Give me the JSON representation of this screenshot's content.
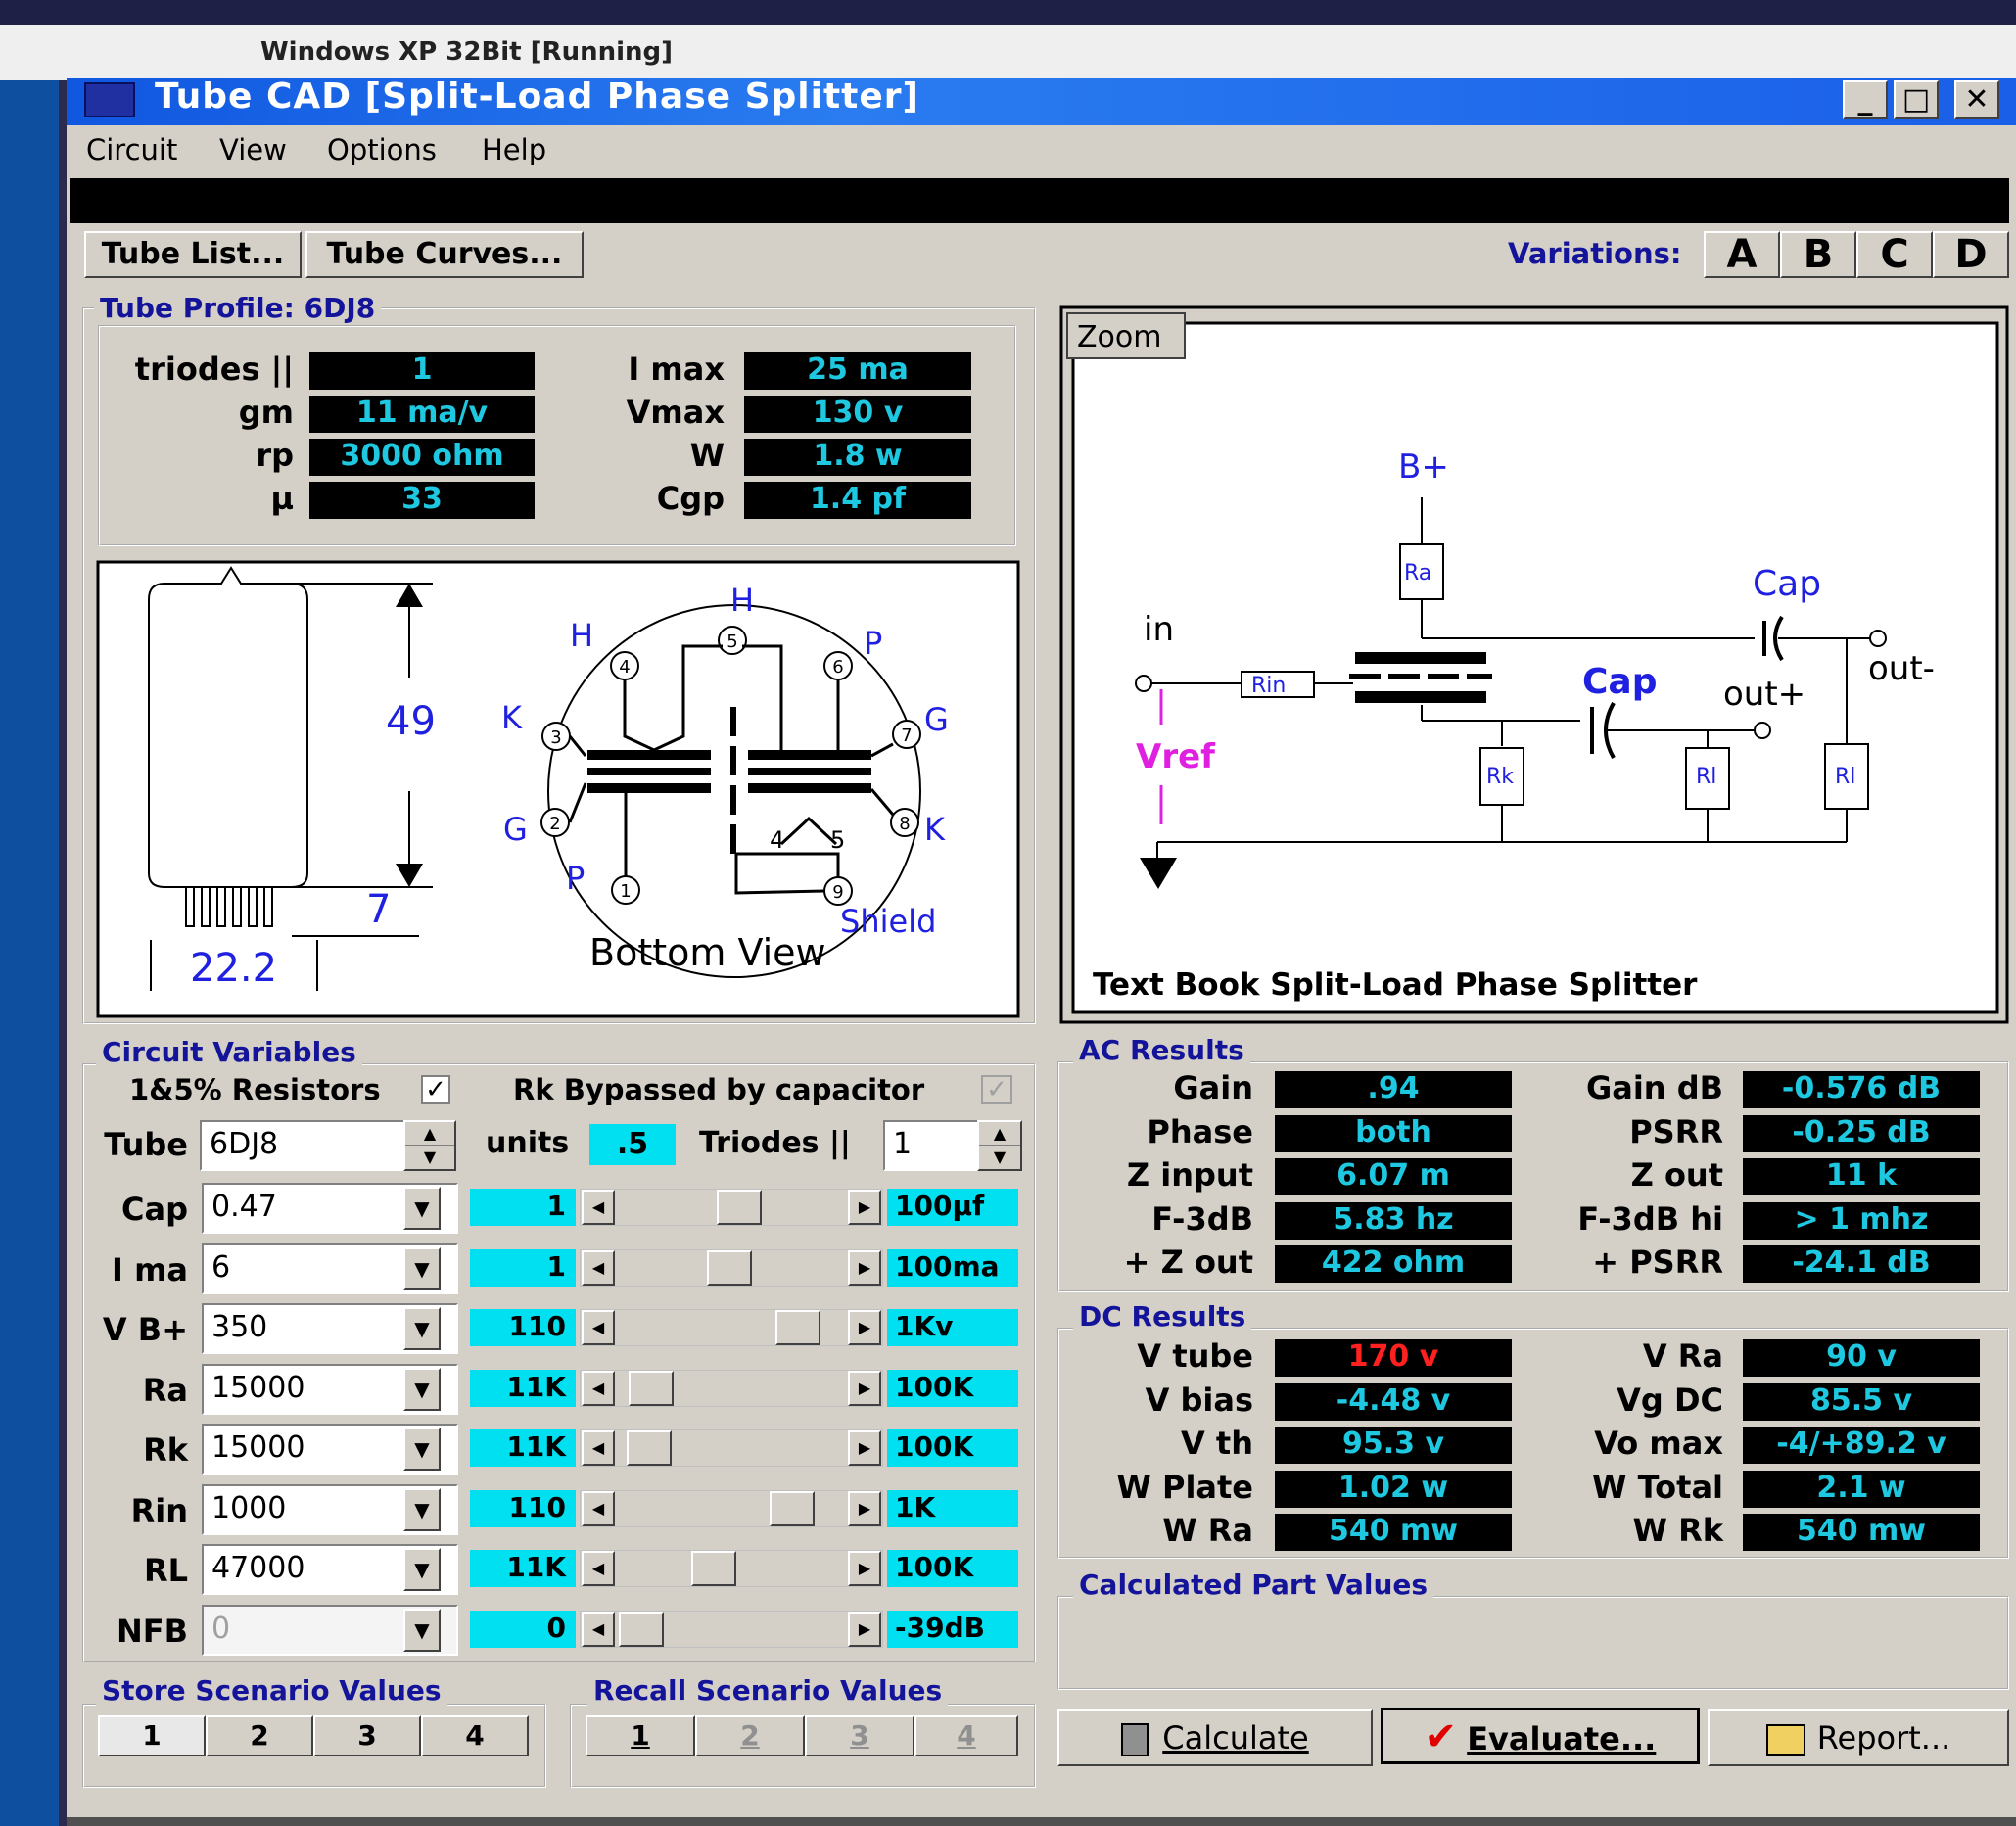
{
  "vm_title": "Windows XP 32Bit [Running]",
  "app": {
    "title": "Tube CAD    [Split-Load Phase Splitter]",
    "min_btn": "_",
    "max_btn": "□",
    "close_btn": "✕"
  },
  "menu": [
    "Circuit",
    "View",
    "Options",
    "Help"
  ],
  "toolbar": {
    "tube_list": "Tube List...",
    "tube_curves": "Tube Curves...",
    "variations_label": "Variations:",
    "variations": [
      "A",
      "B",
      "C",
      "D"
    ]
  },
  "tube_profile": {
    "title": "Tube Profile: 6DJ8",
    "left": [
      {
        "label": "triodes ||",
        "value": "1"
      },
      {
        "label": "gm",
        "value": "11 ma/v"
      },
      {
        "label": "rp",
        "value": "3000 ohm"
      },
      {
        "label": "µ",
        "value": "33"
      }
    ],
    "right": [
      {
        "label": "I max",
        "value": "25 ma"
      },
      {
        "label": "Vmax",
        "value": "130 v"
      },
      {
        "label": "W",
        "value": "1.8 w"
      },
      {
        "label": "Cgp",
        "value": "1.4 pf"
      }
    ]
  },
  "tube_drawing": {
    "height": "49",
    "pin_len": "7",
    "diameter": "22.2",
    "bottom_view": "Bottom View",
    "pins": [
      "1",
      "2",
      "3",
      "4",
      "5",
      "6",
      "7",
      "8",
      "9"
    ],
    "labels": {
      "h1": "H",
      "h2": "H",
      "p1": "P",
      "k1": "K",
      "g1": "G",
      "g2": "G",
      "k2": "K",
      "p2": "P",
      "shield": "Shield",
      "h4": "4",
      "h5": "5"
    }
  },
  "schematic": {
    "zoom": "Zoom",
    "caption": "Text Book Split-Load Phase Splitter",
    "bplus": "B+",
    "ra": "Ra",
    "cap1": "Cap",
    "cap2": "Cap",
    "in": "in",
    "rin": "Rin",
    "out_minus": "out-",
    "out_plus": "out+",
    "vref": "Vref",
    "rk": "Rk",
    "rl1": "Rl",
    "rl2": "Rl"
  },
  "circuit_variables": {
    "title": "Circuit Variables",
    "resistors": "1&5% Resistors",
    "rk_bypass": "Rk Bypassed by capacitor",
    "tube_label": "Tube",
    "tube_value": "6DJ8",
    "units_label": "units",
    "units_value": ".5",
    "triodes_label": "Triodes ||",
    "triodes_value": "1",
    "rows": [
      {
        "label": "Cap",
        "value": "0.47",
        "min": "1",
        "max": "100µf"
      },
      {
        "label": "I ma",
        "value": "6",
        "min": "1",
        "max": "100ma"
      },
      {
        "label": "V B+",
        "value": "350",
        "min": "110",
        "max": "1Kv"
      },
      {
        "label": "Ra",
        "value": "15000",
        "min": "11K",
        "max": "100K"
      },
      {
        "label": "Rk",
        "value": "15000",
        "min": "11K",
        "max": "100K"
      },
      {
        "label": "Rin",
        "value": "1000",
        "min": "110",
        "max": "1K"
      },
      {
        "label": "RL",
        "value": "47000",
        "min": "11K",
        "max": "100K"
      },
      {
        "label": "NFB",
        "value": "0",
        "min": "0",
        "max": "-39dB"
      }
    ]
  },
  "ac_results": {
    "title": "AC Results",
    "left": [
      {
        "label": "Gain",
        "value": ".94"
      },
      {
        "label": "Phase",
        "value": "both"
      },
      {
        "label": "Z input",
        "value": "6.07 m"
      },
      {
        "label": "F-3dB",
        "value": "5.83 hz"
      },
      {
        "label": "+ Z out",
        "value": "422 ohm"
      }
    ],
    "right": [
      {
        "label": "Gain dB",
        "value": "-0.576 dB"
      },
      {
        "label": "PSRR",
        "value": "-0.25 dB"
      },
      {
        "label": "Z out",
        "value": "11 k"
      },
      {
        "label": "F-3dB hi",
        "value": "> 1 mhz"
      },
      {
        "label": "+ PSRR",
        "value": "-24.1 dB"
      }
    ]
  },
  "dc_results": {
    "title": "DC Results",
    "left": [
      {
        "label": "V tube",
        "value": "170 v"
      },
      {
        "label": "V bias",
        "value": "-4.48 v"
      },
      {
        "label": "V th",
        "value": "95.3 v"
      },
      {
        "label": "W Plate",
        "value": "1.02 w"
      },
      {
        "label": "W Ra",
        "value": "540 mw"
      }
    ],
    "right": [
      {
        "label": "V Ra",
        "value": "90 v"
      },
      {
        "label": "Vg DC",
        "value": "85.5 v"
      },
      {
        "label": "Vo max",
        "value": "-4/+89.2 v"
      },
      {
        "label": "W Total",
        "value": "2.1 w"
      },
      {
        "label": "W Rk",
        "value": "540 mw"
      }
    ]
  },
  "calculated_part_values": {
    "title": "Calculated Part Values"
  },
  "store": {
    "title": "Store Scenario Values",
    "buttons": [
      "1",
      "2",
      "3",
      "4"
    ]
  },
  "recall": {
    "title": "Recall Scenario Values",
    "buttons": [
      "1",
      "2",
      "3",
      "4"
    ]
  },
  "actions": {
    "calculate": "Calculate",
    "evaluate": "Evaluate...",
    "report": "Report..."
  }
}
